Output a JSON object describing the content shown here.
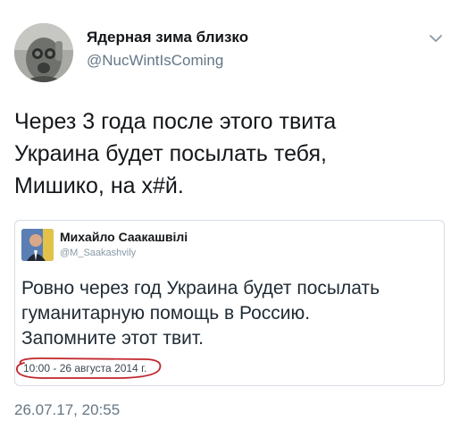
{
  "tweet": {
    "author": {
      "display_name": "Ядерная зима близко",
      "handle": "@NucWintIsComing",
      "avatar_icon": "gas-mask-avatar"
    },
    "menu_icon": "chevron-down-icon",
    "text_lines": [
      "Через 3 года после этого твита",
      "Украина будет посылать тебя,",
      "Мишико, на х#й."
    ],
    "timestamp": "26.07.17, 20:55"
  },
  "quoted_tweet": {
    "author": {
      "display_name": "Михайло Саакашвілі",
      "handle": "@M_Saakashvily",
      "avatar_icon": "person-avatar"
    },
    "text_lines": [
      "Ровно через год Украина будет посылать",
      "гуманитарную помощь в Россию.",
      "Запомните этот твит."
    ],
    "timestamp": "10:00 - 26 августа 2014 г.",
    "highlight_color": "#c0262d"
  },
  "colors": {
    "text_primary": "#14171a",
    "text_secondary": "#657786",
    "border": "#d6dde3"
  }
}
